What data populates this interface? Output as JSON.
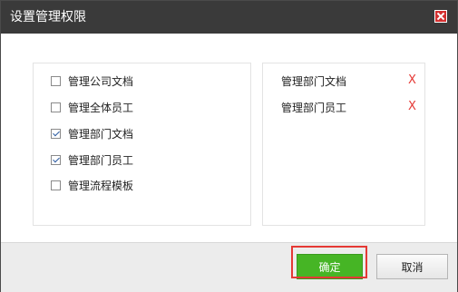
{
  "dialog": {
    "title": "设置管理权限",
    "close_icon": "close-icon"
  },
  "options": [
    {
      "label": "管理公司文档",
      "checked": false
    },
    {
      "label": "管理全体员工",
      "checked": false
    },
    {
      "label": "管理部门文档",
      "checked": true
    },
    {
      "label": "管理部门员工",
      "checked": true
    },
    {
      "label": "管理流程模板",
      "checked": false
    }
  ],
  "selected": [
    {
      "label": "管理部门文档",
      "remove": "X"
    },
    {
      "label": "管理部门员工",
      "remove": "X"
    }
  ],
  "buttons": {
    "ok": "确定",
    "cancel": "取消"
  },
  "colors": {
    "titlebar": "#3a3a3a",
    "accent_green": "#46b525",
    "highlight_red": "#e53935",
    "highlight_fill": "#fdfbd3"
  }
}
